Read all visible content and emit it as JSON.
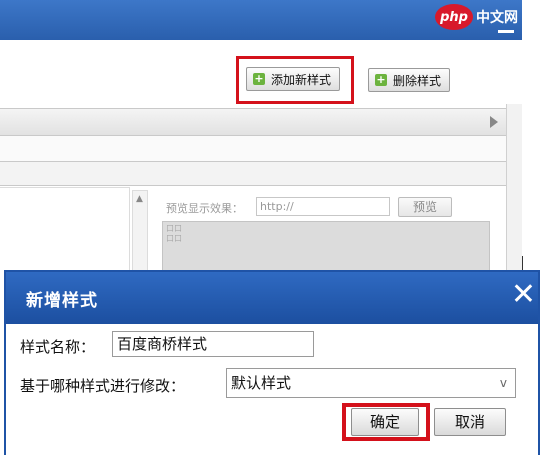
{
  "watermark": {
    "logo": "php",
    "text": "中文网"
  },
  "toolbar": {
    "add_style_label": "添加新样式",
    "delete_style_label": "删除样式"
  },
  "preview": {
    "label": "预览显示效果：",
    "url_value": "http://",
    "button_label": "预览",
    "box_lines": [
      "口口",
      "口口"
    ]
  },
  "dialog": {
    "title": "新增样式",
    "close_glyph": "✕",
    "style_name_label": "样式名称：",
    "style_name_value": "百度商桥样式",
    "base_style_label": "基于哪种样式进行修改：",
    "base_style_value": "默认样式",
    "ok_label": "确定",
    "cancel_label": "取消"
  },
  "icons": {
    "plus": "plus-icon",
    "close": "close-icon",
    "dropdown": "chevron-down-icon",
    "scroll": "scroll-right-icon"
  },
  "colors": {
    "header_blue": "#2a5fad",
    "highlight_red": "#d4111b",
    "plus_green": "#6cb33e"
  }
}
